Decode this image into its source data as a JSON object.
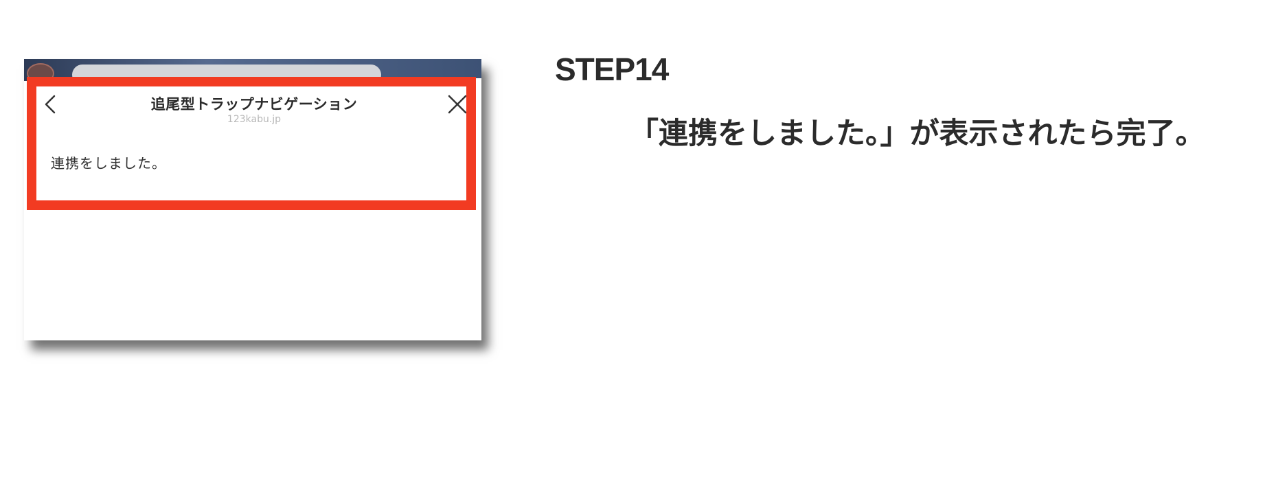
{
  "screenshot": {
    "title": "追尾型トラップナビゲーション",
    "domain": "123kabu.jp",
    "message": "連携をしました。",
    "back_icon": "chevron-left-icon",
    "close_icon": "close-icon",
    "highlight_color": "#f23b22"
  },
  "instructions": {
    "step": "STEP14",
    "text": "「連携をしました。」が表示されたら完了。"
  }
}
